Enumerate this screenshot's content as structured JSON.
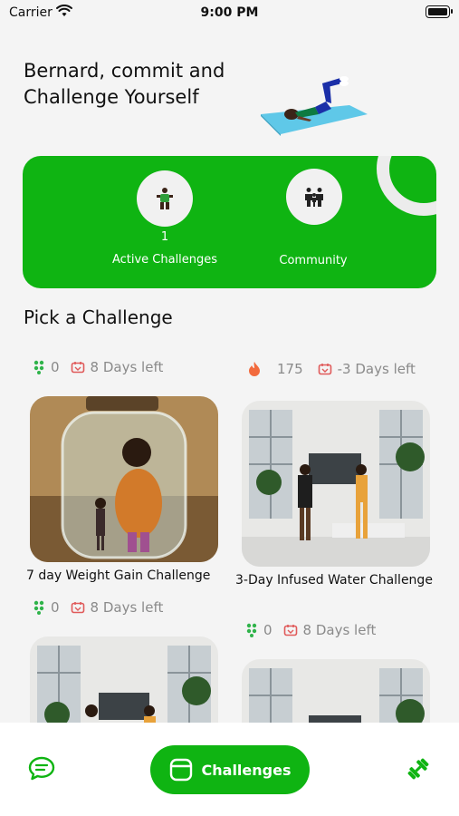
{
  "status_bar": {
    "carrier": "Carrier",
    "time": "9:00 PM"
  },
  "header": {
    "title": "Bernard, commit and Challenge Yourself"
  },
  "stats": {
    "active_count": "1",
    "active_label": "Active Challenges",
    "community_label": "Community"
  },
  "section": {
    "title": "Pick a Challenge"
  },
  "challenges": [
    {
      "title": "7 day Weight Gain Challenge",
      "participants": "0",
      "days_left": "8 Days left"
    },
    {
      "title": "3-Day Infused Water Challenge",
      "participants": "175",
      "days_left": "-3 Days left"
    },
    {
      "participants": "0",
      "days_left": "8 Days left"
    },
    {
      "participants": "0",
      "days_left": "8 Days left"
    }
  ],
  "bottom_nav": {
    "challenges_label": "Challenges"
  },
  "colors": {
    "accent": "#0fb412",
    "muted_text": "#8a8a8a",
    "flame": "#f26a3d",
    "days_icon": "#e05a5a"
  }
}
